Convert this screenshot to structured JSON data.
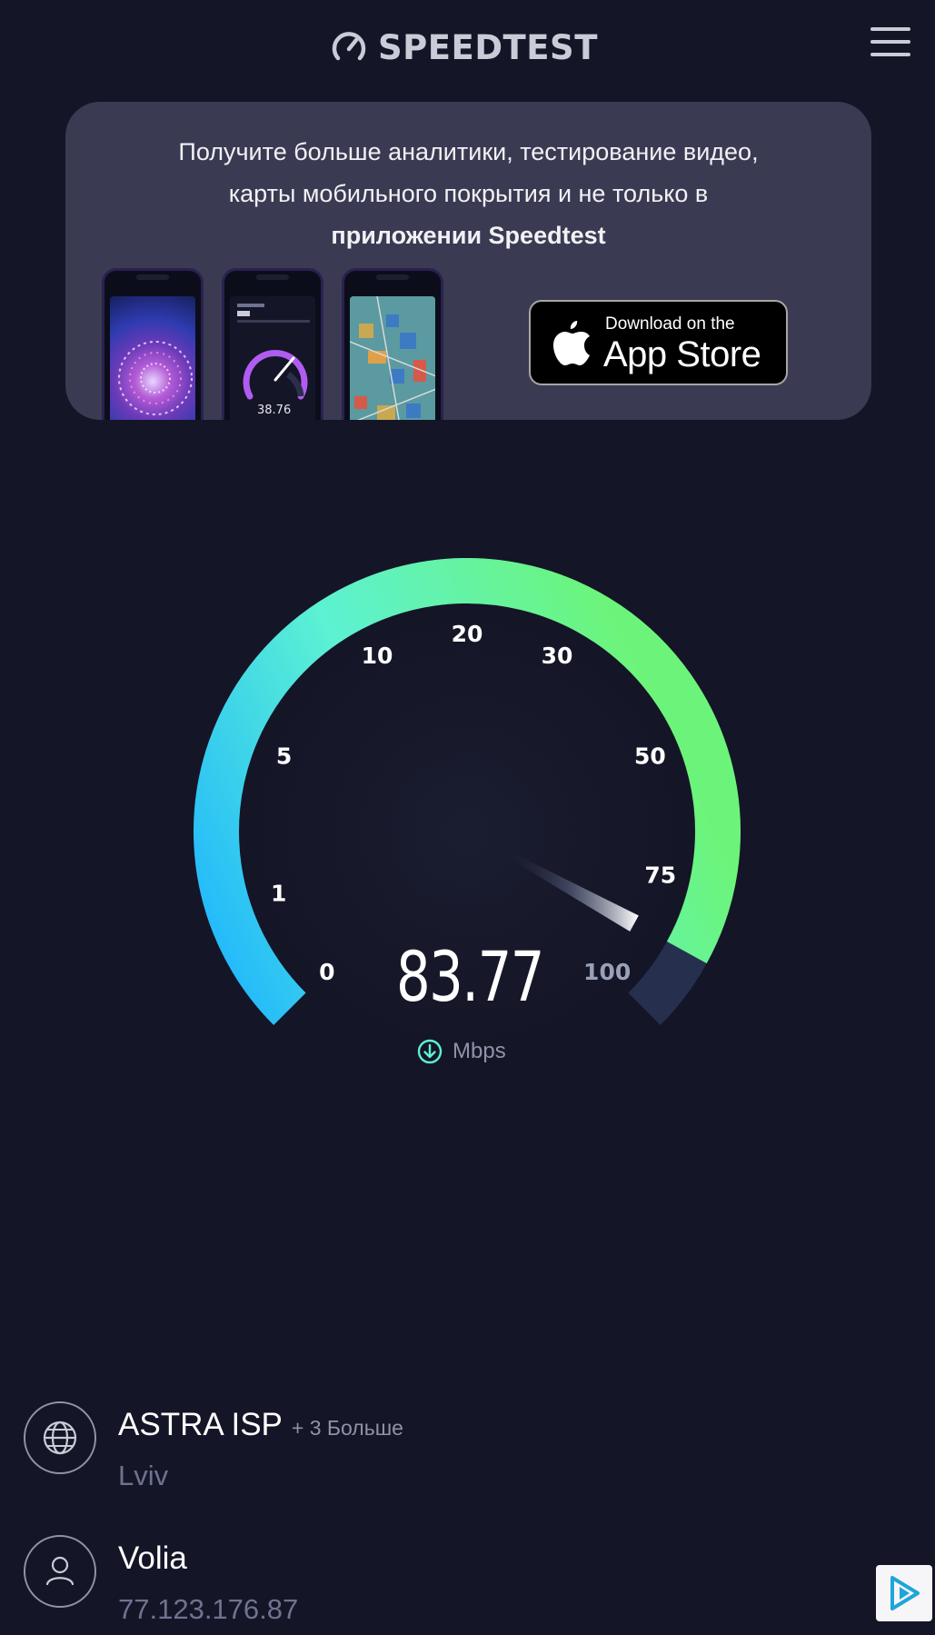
{
  "header": {
    "logo_text": "SPEEDTEST",
    "logo_icon": "speedometer-icon",
    "menu_icon": "hamburger-menu-icon"
  },
  "promo": {
    "line1": "Получите больше аналитики, тестирование видео,",
    "line2": "карты мобильного покрытия и не только в",
    "line3_bold": "приложении Speedtest",
    "phone2_value": "38.76",
    "appstore_small": "Download on the",
    "appstore_big": "App Store",
    "appstore_icon": "apple-icon"
  },
  "gauge": {
    "ticks": [
      "0",
      "1",
      "5",
      "10",
      "20",
      "30",
      "50",
      "75",
      "100"
    ],
    "speed_value": "83.77",
    "unit": "Mbps",
    "unit_icon": "download-arrow-icon",
    "needle_position_fraction": 0.94,
    "colors": {
      "arc_start": "#1eb4ff",
      "arc_mid": "#5cf2d3",
      "arc_end": "#6cf47a",
      "arc_track": "#26304e"
    }
  },
  "server": {
    "isp_name": "ASTRA ISP",
    "isp_more": "+ 3 Больше",
    "isp_location": "Lviv",
    "isp_icon": "globe-icon",
    "host_name": "Volia",
    "host_ip": "77.123.176.87",
    "host_icon": "user-icon"
  },
  "ad": {
    "icon": "ad-choices-icon"
  }
}
